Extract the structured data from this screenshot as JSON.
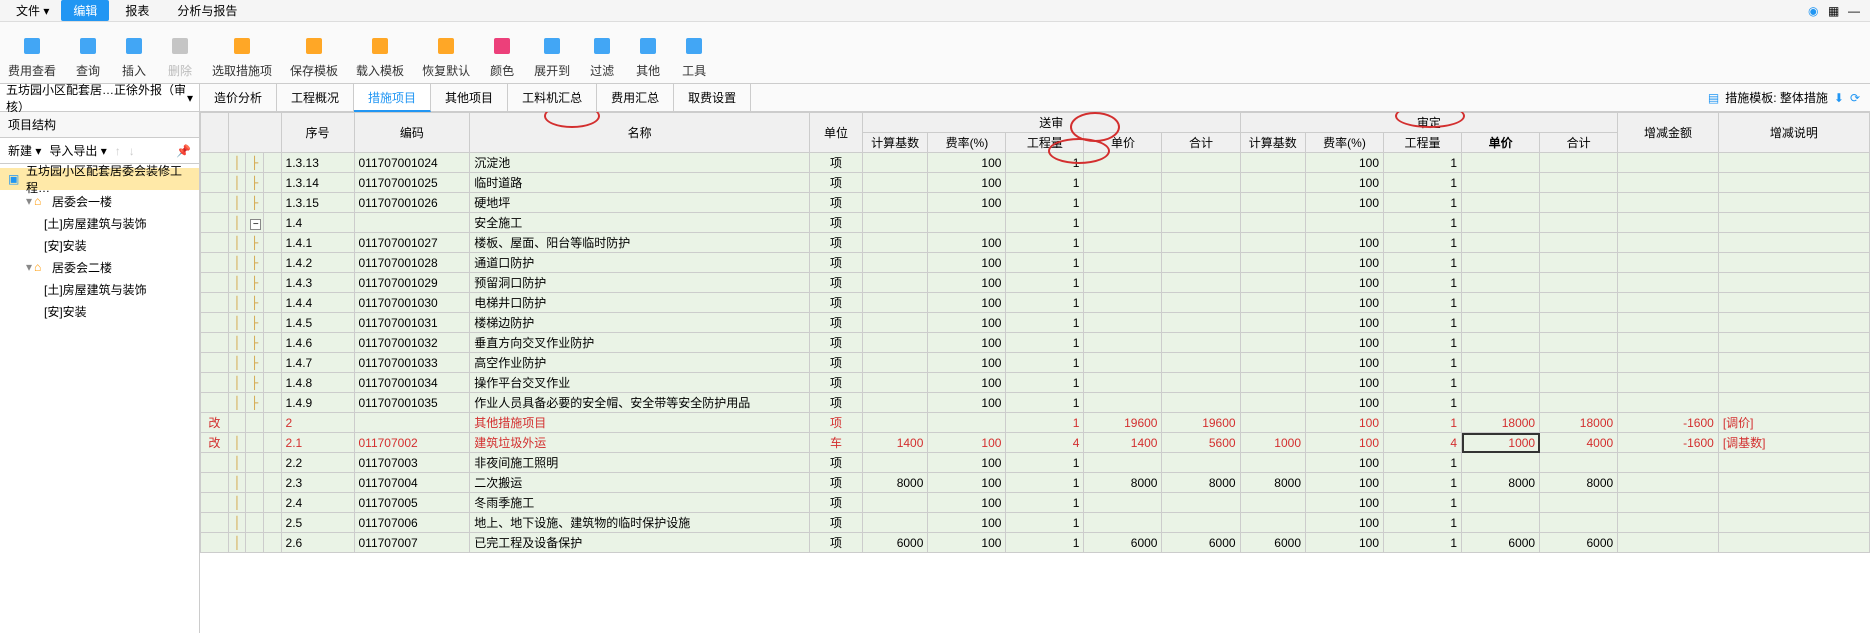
{
  "menu": {
    "file": "文件",
    "edit": "编辑",
    "report": "报表",
    "analysis": "分析与报告"
  },
  "ribbon": [
    {
      "id": "fee-view",
      "label": "费用查看"
    },
    {
      "id": "query",
      "label": "查询"
    },
    {
      "id": "insert",
      "label": "插入"
    },
    {
      "id": "delete",
      "label": "删除",
      "disabled": true
    },
    {
      "id": "select-measure",
      "label": "选取措施项"
    },
    {
      "id": "save-tpl",
      "label": "保存模板"
    },
    {
      "id": "load-tpl",
      "label": "载入模板"
    },
    {
      "id": "restore-default",
      "label": "恢复默认"
    },
    {
      "id": "color",
      "label": "颜色"
    },
    {
      "id": "expand",
      "label": "展开到"
    },
    {
      "id": "filter",
      "label": "过滤"
    },
    {
      "id": "other",
      "label": "其他"
    },
    {
      "id": "tools",
      "label": "工具"
    }
  ],
  "sidebar": {
    "project_dropdown": "五坊园小区配套居…正徐外报（审核）",
    "tab": "项目结构",
    "new": "新建",
    "ie": "导入导出",
    "tree": [
      {
        "label": "五坊园小区配套居委会装修工程…",
        "depth": 0,
        "sel": true,
        "icon": "building"
      },
      {
        "label": "居委会一楼",
        "depth": 1,
        "icon": "home",
        "exp": "▾"
      },
      {
        "label": "[土]房屋建筑与装饰",
        "depth": 2
      },
      {
        "label": "[安]安装",
        "depth": 2
      },
      {
        "label": "居委会二楼",
        "depth": 1,
        "icon": "home",
        "exp": "▾"
      },
      {
        "label": "[土]房屋建筑与装饰",
        "depth": 2
      },
      {
        "label": "[安]安装",
        "depth": 2
      }
    ]
  },
  "tabs": [
    "造价分析",
    "工程概况",
    "措施项目",
    "其他项目",
    "工料机汇总",
    "费用汇总",
    "取费设置"
  ],
  "active_tab": 2,
  "template": {
    "label": "措施模板: 整体措施",
    "icon": "template"
  },
  "headers": {
    "xh": "序号",
    "bm": "编码",
    "mc": "名称",
    "dw": "单位",
    "send": "送审",
    "approve": "审定",
    "jsjs": "计算基数",
    "fl": "费率(%)",
    "gcl": "工程量",
    "dj": "单价",
    "hj": "合计",
    "zj": "增减金额",
    "sm": "增减说明"
  },
  "rows": [
    {
      "xh": "1.3.13",
      "bm": "011707001024",
      "mc": "沉淀池",
      "dw": "项",
      "s_fl": "100",
      "s_gcl": "1",
      "a_fl": "100",
      "a_gcl": "1"
    },
    {
      "xh": "1.3.14",
      "bm": "011707001025",
      "mc": "临时道路",
      "dw": "项",
      "s_fl": "100",
      "s_gcl": "1",
      "a_fl": "100",
      "a_gcl": "1"
    },
    {
      "xh": "1.3.15",
      "bm": "011707001026",
      "mc": "硬地坪",
      "dw": "项",
      "s_fl": "100",
      "s_gcl": "1",
      "a_fl": "100",
      "a_gcl": "1"
    },
    {
      "xh": "1.4",
      "bm": "",
      "mc": "安全施工",
      "dw": "项",
      "s_gcl": "1",
      "a_gcl": "1",
      "exp": "-"
    },
    {
      "xh": "1.4.1",
      "bm": "011707001027",
      "mc": "楼板、屋面、阳台等临时防护",
      "dw": "项",
      "s_fl": "100",
      "s_gcl": "1",
      "a_fl": "100",
      "a_gcl": "1"
    },
    {
      "xh": "1.4.2",
      "bm": "011707001028",
      "mc": "通道口防护",
      "dw": "项",
      "s_fl": "100",
      "s_gcl": "1",
      "a_fl": "100",
      "a_gcl": "1"
    },
    {
      "xh": "1.4.3",
      "bm": "011707001029",
      "mc": "预留洞口防护",
      "dw": "项",
      "s_fl": "100",
      "s_gcl": "1",
      "a_fl": "100",
      "a_gcl": "1"
    },
    {
      "xh": "1.4.4",
      "bm": "011707001030",
      "mc": "电梯井口防护",
      "dw": "项",
      "s_fl": "100",
      "s_gcl": "1",
      "a_fl": "100",
      "a_gcl": "1"
    },
    {
      "xh": "1.4.5",
      "bm": "011707001031",
      "mc": "楼梯边防护",
      "dw": "项",
      "s_fl": "100",
      "s_gcl": "1",
      "a_fl": "100",
      "a_gcl": "1"
    },
    {
      "xh": "1.4.6",
      "bm": "011707001032",
      "mc": "垂直方向交叉作业防护",
      "dw": "项",
      "s_fl": "100",
      "s_gcl": "1",
      "a_fl": "100",
      "a_gcl": "1"
    },
    {
      "xh": "1.4.7",
      "bm": "011707001033",
      "mc": "高空作业防护",
      "dw": "项",
      "s_fl": "100",
      "s_gcl": "1",
      "a_fl": "100",
      "a_gcl": "1"
    },
    {
      "xh": "1.4.8",
      "bm": "011707001034",
      "mc": "操作平台交叉作业",
      "dw": "项",
      "s_fl": "100",
      "s_gcl": "1",
      "a_fl": "100",
      "a_gcl": "1"
    },
    {
      "xh": "1.4.9",
      "bm": "011707001035",
      "mc": "作业人员具备必要的安全帽、安全带等安全防护用品",
      "dw": "项",
      "s_fl": "100",
      "s_gcl": "1",
      "a_fl": "100",
      "a_gcl": "1"
    },
    {
      "mark": "改",
      "xh": "2",
      "bm": "",
      "mc": "其他措施项目",
      "dw": "项",
      "s_gcl": "1",
      "s_dj": "19600",
      "s_hj": "19600",
      "a_fl": "100",
      "a_gcl": "1",
      "a_dj": "18000",
      "a_hj": "18000",
      "zj": "-1600",
      "sm": "[调价]",
      "red": true,
      "exp": "-"
    },
    {
      "mark": "改",
      "xh": "2.1",
      "bm": "011707002",
      "mc": "建筑垃圾外运",
      "dw": "车",
      "s_jsjs": "1400",
      "s_fl": "100",
      "s_gcl": "4",
      "s_dj": "1400",
      "s_hj": "5600",
      "a_jsjs": "1000",
      "a_fl": "100",
      "a_gcl": "4",
      "a_dj": "1000",
      "a_hj": "4000",
      "zj": "-1600",
      "sm": "[调基数]",
      "red": true,
      "sel": true
    },
    {
      "xh": "2.2",
      "bm": "011707003",
      "mc": "非夜间施工照明",
      "dw": "项",
      "s_fl": "100",
      "s_gcl": "1",
      "a_fl": "100",
      "a_gcl": "1"
    },
    {
      "xh": "2.3",
      "bm": "011707004",
      "mc": "二次搬运",
      "dw": "项",
      "s_jsjs": "8000",
      "s_fl": "100",
      "s_gcl": "1",
      "s_dj": "8000",
      "s_hj": "8000",
      "a_jsjs": "8000",
      "a_fl": "100",
      "a_gcl": "1",
      "a_dj": "8000",
      "a_hj": "8000"
    },
    {
      "xh": "2.4",
      "bm": "011707005",
      "mc": "冬雨季施工",
      "dw": "项",
      "s_fl": "100",
      "s_gcl": "1",
      "a_fl": "100",
      "a_gcl": "1"
    },
    {
      "xh": "2.5",
      "bm": "011707006",
      "mc": "地上、地下设施、建筑物的临时保护设施",
      "dw": "项",
      "s_fl": "100",
      "s_gcl": "1",
      "a_fl": "100",
      "a_gcl": "1"
    },
    {
      "xh": "2.6",
      "bm": "011707007",
      "mc": "已完工程及设备保护",
      "dw": "项",
      "s_jsjs": "6000",
      "s_fl": "100",
      "s_gcl": "1",
      "s_dj": "6000",
      "s_hj": "6000",
      "a_jsjs": "6000",
      "a_fl": "100",
      "a_gcl": "1",
      "a_dj": "6000",
      "a_hj": "6000"
    }
  ]
}
